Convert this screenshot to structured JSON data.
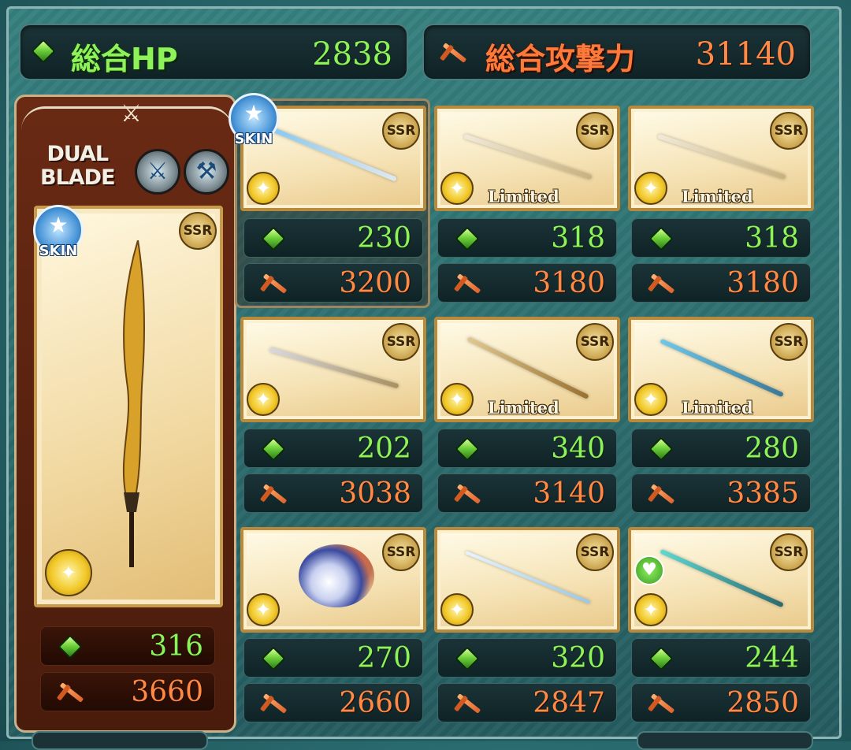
{
  "totals": {
    "hp": {
      "label": "総合HP",
      "value": "2838"
    },
    "attack": {
      "label": "総合攻撃力",
      "value": "31140"
    }
  },
  "main_weapon": {
    "class_label_line1": "DUAL",
    "class_label_line2": "BLADE",
    "skin_label": "SKIN",
    "rarity": "SSR",
    "hp": "316",
    "attack": "3660",
    "icons": [
      "gem-icon",
      "sword-icon",
      "wind-element-icon",
      "skin-star-icon"
    ]
  },
  "grid": {
    "skin_label": "SKIN",
    "limited_label": "Limited",
    "rarity": "SSR",
    "weapons": [
      {
        "hp": "230",
        "attack": "3200",
        "limited": false,
        "skin": true
      },
      {
        "hp": "318",
        "attack": "3180",
        "limited": true,
        "skin": false
      },
      {
        "hp": "318",
        "attack": "3180",
        "limited": true,
        "skin": false
      },
      {
        "hp": "202",
        "attack": "3038",
        "limited": false,
        "skin": false
      },
      {
        "hp": "340",
        "attack": "3140",
        "limited": true,
        "skin": false
      },
      {
        "hp": "280",
        "attack": "3385",
        "limited": true,
        "skin": false
      },
      {
        "hp": "270",
        "attack": "2660",
        "limited": false,
        "skin": false
      },
      {
        "hp": "320",
        "attack": "2847",
        "limited": false,
        "skin": false
      },
      {
        "hp": "244",
        "attack": "2850",
        "limited": false,
        "skin": false,
        "favorite": true
      }
    ]
  },
  "colors": {
    "hp_green": "#8ef25a",
    "attack_orange": "#ff8a45",
    "panel_teal": "#2b6a6c",
    "card_gold": "#b98a3c"
  }
}
